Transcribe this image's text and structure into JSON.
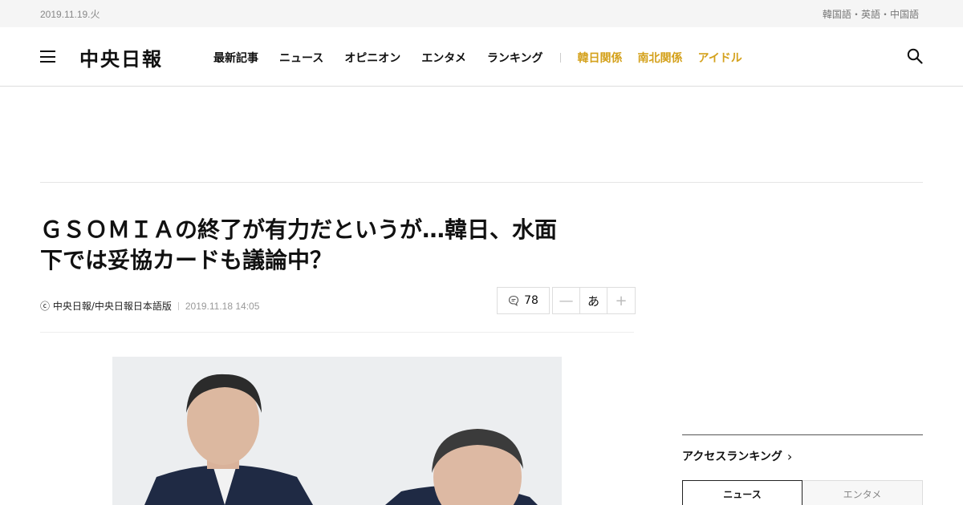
{
  "topbar": {
    "date": "2019.11.19.火",
    "langs": [
      "韓国語",
      "英語",
      "中国語"
    ],
    "sep": "・"
  },
  "header": {
    "logo": "中央日報",
    "nav": [
      "最新記事",
      "ニュース",
      "オピニオン",
      "エンタメ",
      "ランキング"
    ],
    "nav_hot": [
      "韓日関係",
      "南北関係",
      "アイドル"
    ]
  },
  "article": {
    "title_line1": "ＧＳＯＭＩＡの終了が有力だというが…韓日、水面",
    "title_line2": "下では妥協カードも議論中？",
    "source": "ⓒ 中央日報/中央日報日本語版",
    "datetime": "2019.11.18 14:05",
    "comment_count": "78",
    "font_decrease": "—",
    "font_label": "あ",
    "font_increase": "+"
  },
  "sidebar": {
    "ranking_title": "アクセスランキング",
    "ranking_chevron": "›",
    "tabs": [
      "ニュース",
      "エンタメ"
    ]
  },
  "colors": {
    "accent": "#d4a11c"
  }
}
